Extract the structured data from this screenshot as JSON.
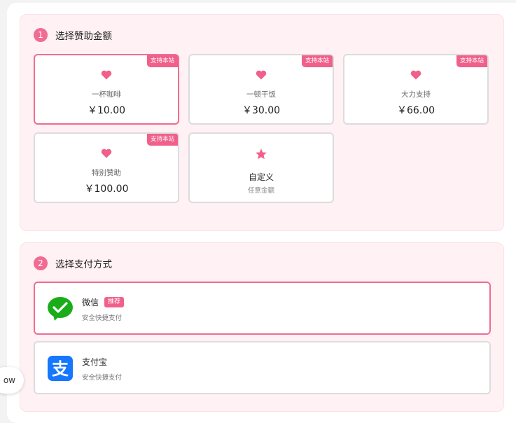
{
  "section1": {
    "step": "1",
    "title": "选择赞助金额",
    "badge": "支持本站",
    "options": [
      {
        "name": "一杯咖啡",
        "price": "￥10.00",
        "selected": true
      },
      {
        "name": "一顿干饭",
        "price": "￥30.00",
        "selected": false
      },
      {
        "name": "大力支持",
        "price": "￥66.00",
        "selected": false
      },
      {
        "name": "特别赞助",
        "price": "￥100.00",
        "selected": false
      }
    ],
    "custom": {
      "name": "自定义",
      "sub": "任意金额"
    }
  },
  "section2": {
    "step": "2",
    "title": "选择支付方式",
    "methods": [
      {
        "name": "微信",
        "tag": "推荐",
        "sub": "安全快捷支付",
        "selected": true
      },
      {
        "name": "支付宝",
        "sub": "安全快捷支付",
        "selected": false
      }
    ]
  },
  "floating": {
    "label": "ow"
  },
  "colors": {
    "accent": "#f0608a",
    "wechat": "#1aad19",
    "alipay": "#1677ff",
    "panel": "#fff1f4"
  }
}
